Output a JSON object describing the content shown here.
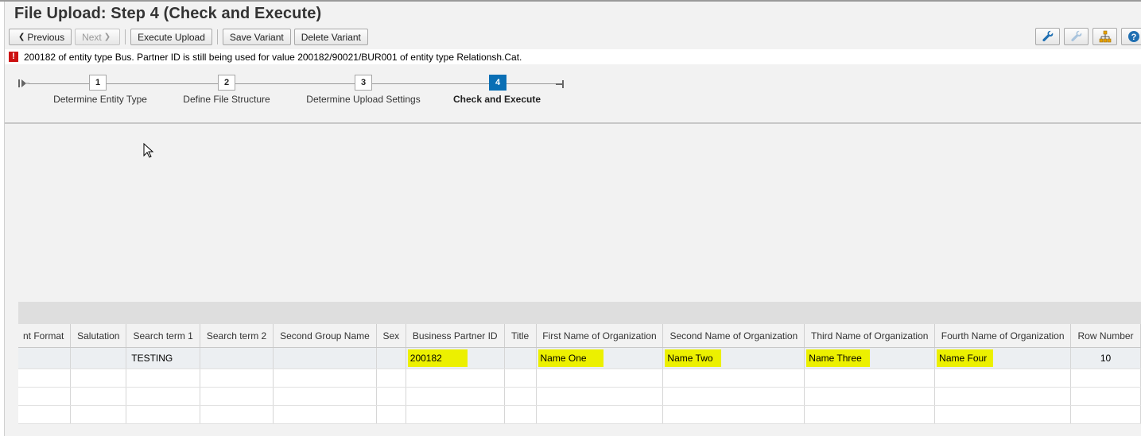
{
  "page": {
    "title": "File Upload: Step 4  (Check and Execute)"
  },
  "toolbar": {
    "previous_label": "Previous",
    "next_label": "Next",
    "execute_upload_label": "Execute Upload",
    "save_variant_label": "Save Variant",
    "delete_variant_label": "Delete Variant",
    "right_icons": [
      "wrench-icon",
      "wrench-disabled-icon",
      "hierarchy-icon",
      "help-icon"
    ]
  },
  "message": {
    "type": "error",
    "icon": "!",
    "text": "200182 of entity type Bus. Partner ID is still being used for value 200182/90021/BUR001 of entity type Relationsh.Cat."
  },
  "roadmap": {
    "steps": [
      {
        "number": "1",
        "label": "Determine Entity Type",
        "active": false
      },
      {
        "number": "2",
        "label": "Define File Structure",
        "active": false
      },
      {
        "number": "3",
        "label": "Determine Upload Settings",
        "active": false
      },
      {
        "number": "4",
        "label": "Check and Execute",
        "active": true
      }
    ]
  },
  "table": {
    "columns": [
      "nt Format",
      "Salutation",
      "Search term 1",
      "Search term 2",
      "Second Group Name",
      "Sex",
      "Business Partner ID",
      "Title",
      "First Name of Organization",
      "Second Name of Organization",
      "Third Name of Organization",
      "Fourth Name of Organization",
      "Row Number"
    ],
    "rows": [
      [
        "",
        "",
        "TESTING",
        "",
        "",
        "",
        "200182",
        "",
        "Name One",
        "Name Two",
        "Name Three",
        "Name Four",
        "10"
      ]
    ]
  },
  "colors": {
    "highlight": "#ecf000",
    "active_step": "#0a6fb5",
    "error": "#cc1111"
  }
}
